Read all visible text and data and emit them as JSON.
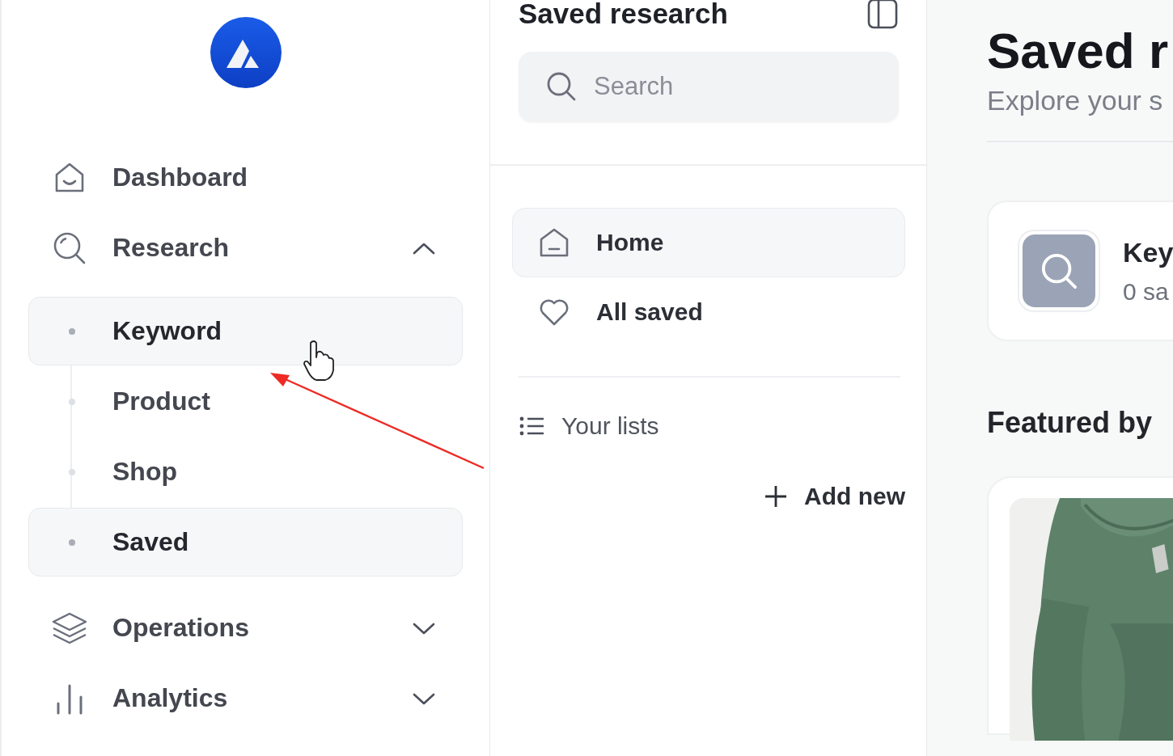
{
  "sidebar": {
    "items": [
      {
        "kind": "link",
        "label": "Dashboard"
      },
      {
        "kind": "group",
        "label": "Research",
        "expanded": true,
        "children": [
          {
            "label": "Keyword",
            "selected": true
          },
          {
            "label": "Product",
            "selected": false
          },
          {
            "label": "Shop",
            "selected": false
          },
          {
            "label": "Saved",
            "selected": true
          }
        ]
      },
      {
        "kind": "group",
        "label": "Operations",
        "expanded": false
      },
      {
        "kind": "group",
        "label": "Analytics",
        "expanded": false
      }
    ]
  },
  "middle": {
    "title": "Saved research",
    "search": {
      "placeholder": "Search"
    },
    "nav": [
      {
        "label": "Home",
        "selected": true
      },
      {
        "label": "All saved",
        "selected": false
      }
    ],
    "lists_heading": "Your lists",
    "add_button": "Add new"
  },
  "main": {
    "title": "Saved r",
    "subtitle": "Explore your s",
    "cards": [
      {
        "title": "Key",
        "count": "0 sa"
      }
    ],
    "featured_heading": "Featured by"
  }
}
